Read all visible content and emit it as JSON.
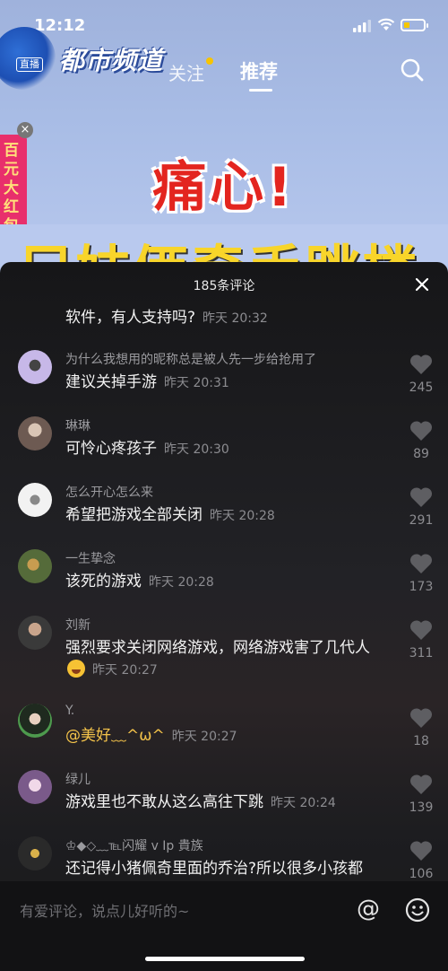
{
  "status": {
    "time": "12:12"
  },
  "channel": {
    "logo": "都市频道",
    "live_tag": "直播"
  },
  "tabs": {
    "follow": "关注",
    "recommend": "推荐"
  },
  "promo": {
    "text": "百元大红包"
  },
  "video": {
    "headline": "痛心!",
    "subhead": "兄妹俩牵手跳楼"
  },
  "comments_header": {
    "title": "185条评论"
  },
  "partial_comment": {
    "text": "软件，有人支持吗?",
    "time": "昨天 20:32"
  },
  "comments": [
    {
      "name": "为什么我想用的昵称总是被人先一步给抢用了",
      "text": "建议关掉手游",
      "time": "昨天 20:31",
      "likes": "245"
    },
    {
      "name": "琳琳",
      "text": "可怜心疼孩子",
      "time": "昨天 20:30",
      "likes": "89"
    },
    {
      "name": "怎么开心怎么来",
      "text": "希望把游戏全部关闭",
      "time": "昨天 20:28",
      "likes": "291"
    },
    {
      "name": "一生挚念",
      "text": "该死的游戏",
      "time": "昨天 20:28",
      "likes": "173"
    },
    {
      "name": "刘新",
      "text": "强烈要求关闭网络游戏，网络游戏害了几代人",
      "time": "昨天 20:27",
      "likes": "311"
    },
    {
      "name": "Y.",
      "text": "@美好﹏^ω^",
      "time": "昨天 20:27",
      "likes": "18"
    },
    {
      "name": "绿儿",
      "text": "游戏里也不敢从这么高往下跳",
      "time": "昨天 20:24",
      "likes": "139"
    },
    {
      "name": "♔◆◇﹏℡闪耀 v Ip 貴族",
      "text": "还记得小猪佩奇里面的乔治?所以很多小孩都",
      "time": "",
      "likes": "106"
    }
  ],
  "input": {
    "placeholder": "有爱评论，说点儿好听的~"
  },
  "colors": {
    "mention": "#f4c34a",
    "headline": "#e3251f",
    "accent_dot": "#f7c400"
  }
}
